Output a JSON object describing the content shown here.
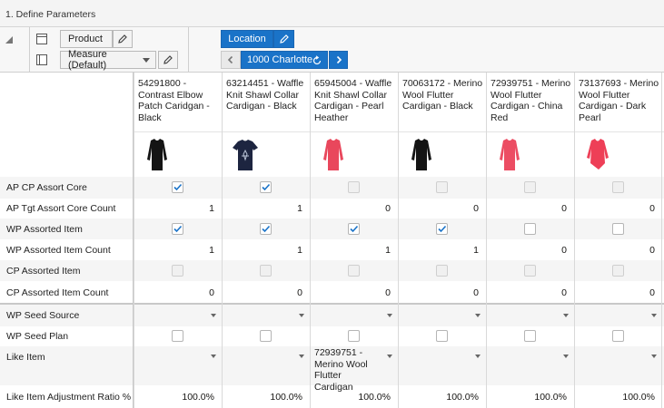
{
  "title_bar": {
    "title": "1. Define Parameters"
  },
  "toolbar": {
    "product_label": "Product",
    "measure_label": "Measure (Default)",
    "location_label": "Location",
    "location_value": "1000 Charlotte"
  },
  "columns": [
    {
      "name": "54291800 - Contrast Elbow Patch Caridgan - Black",
      "lines": [
        "54291800 -",
        "Contrast Elbow",
        "Patch Caridgan -",
        "Black"
      ],
      "thumb_color": "#141414",
      "thumb_shape": "longsleeve"
    },
    {
      "name": "63214451 - Waffle Knit Shawl Collar Cardigan - Black",
      "lines": [
        "63214451 - Waffle",
        "Knit Shawl Collar",
        "Cardigan - Black"
      ],
      "thumb_color": "#1d2540",
      "thumb_shape": "tee"
    },
    {
      "name": "65945004 - Waffle Knit Shawl Collar Cardigan - Pearl Heather",
      "lines": [
        "65945004 - Waffle",
        "Knit Shawl Collar",
        "Cardigan - Pearl",
        "Heather"
      ],
      "thumb_color": "#e9475c",
      "thumb_shape": "longsleeve"
    },
    {
      "name": "70063172 - Merino Wool Flutter Cardigan - Black",
      "lines": [
        "70063172 - Merino",
        "Wool Flutter",
        "Cardigan - Black"
      ],
      "thumb_color": "#141414",
      "thumb_shape": "longsleeve"
    },
    {
      "name": "72939751 - Merino Wool Flutter Cardigan - China Red",
      "lines": [
        "72939751 - Merino",
        "Wool Flutter",
        "Cardigan - China",
        "Red"
      ],
      "thumb_color": "#ec4d63",
      "thumb_shape": "longsleeve"
    },
    {
      "name": "73137693 - Merino Wool Flutter Cardigan - Dark Pearl",
      "lines": [
        "73137693 - Merino",
        "Wool Flutter",
        "Cardigan - Dark",
        "Pearl"
      ],
      "thumb_color": "#ee3f57",
      "thumb_shape": "wrap"
    }
  ],
  "rows": [
    {
      "label": "AP CP Assort Core",
      "type": "checkbox",
      "values": [
        true,
        true,
        false,
        false,
        false,
        false
      ],
      "enabled": [
        true,
        true,
        false,
        false,
        false,
        false
      ]
    },
    {
      "label": "AP Tgt Assort Core Count",
      "type": "number",
      "values": [
        "1",
        "1",
        "0",
        "0",
        "0",
        "0"
      ]
    },
    {
      "label": "WP Assorted Item",
      "type": "checkbox",
      "values": [
        true,
        true,
        true,
        true,
        false,
        false
      ],
      "enabled": [
        true,
        true,
        true,
        true,
        true,
        true
      ]
    },
    {
      "label": "WP Assorted Item Count",
      "type": "number",
      "values": [
        "1",
        "1",
        "1",
        "1",
        "0",
        "0"
      ]
    },
    {
      "label": "CP Assorted Item",
      "type": "checkbox",
      "values": [
        false,
        false,
        false,
        false,
        false,
        false
      ],
      "enabled": [
        false,
        false,
        false,
        false,
        false,
        false
      ]
    },
    {
      "label": "CP Assorted Item Count",
      "type": "number",
      "values": [
        "0",
        "0",
        "0",
        "0",
        "0",
        "0"
      ]
    },
    {
      "label": "WP Seed Source",
      "type": "dropdown",
      "values": [
        "",
        "",
        "",
        "",
        "",
        ""
      ]
    },
    {
      "label": "WP Seed Plan",
      "type": "checkbox",
      "values": [
        false,
        false,
        false,
        false,
        false,
        false
      ],
      "enabled": [
        true,
        true,
        true,
        true,
        true,
        true
      ]
    },
    {
      "label": "Like Item",
      "type": "dropdown",
      "values": [
        "",
        "",
        "72939751 - Merino Wool Flutter Cardigan",
        "",
        "",
        ""
      ]
    },
    {
      "label": "Like Item Adjustment Ratio %",
      "type": "number",
      "values": [
        "100.0%",
        "100.0%",
        "100.0%",
        "100.0%",
        "100.0%",
        "100.0%"
      ]
    }
  ],
  "colors": {
    "accent": "#1a73c8",
    "checkmark": "#1a73c8",
    "grid_line": "#d9d9d9",
    "row_shade": "#f5f5f5"
  },
  "icons": [
    "pencil-icon",
    "layout-rows-icon",
    "layout-columns-icon",
    "chevron-left-icon",
    "chevron-right-icon",
    "refresh-icon",
    "dropdown-caret-icon",
    "checkbox-check-icon"
  ]
}
